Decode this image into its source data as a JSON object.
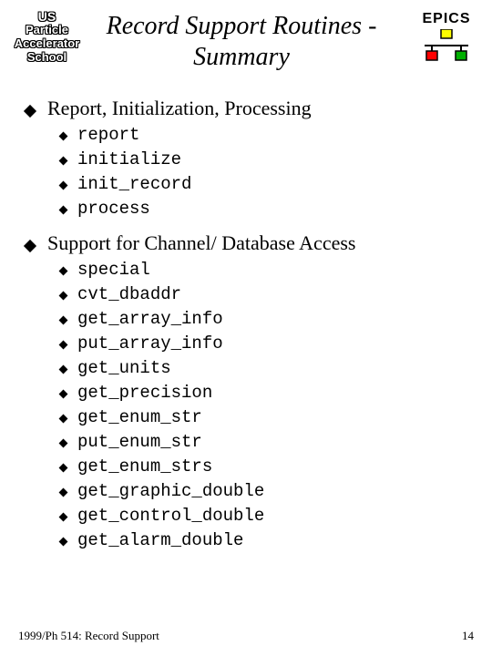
{
  "header": {
    "uspas": {
      "l1": "US",
      "l2": "Particle",
      "l3": "Accelerator",
      "l4": "School"
    },
    "title": "Record Support Routines - Summary",
    "epics_label": "EPICS"
  },
  "sections": [
    {
      "title": "Report, Initialization, Processing",
      "items": [
        "report",
        "initialize",
        "init_record",
        "process"
      ]
    },
    {
      "title": "Support for Channel/ Database Access",
      "items": [
        "special",
        "cvt_dbaddr",
        "get_array_info",
        "put_array_info",
        "get_units",
        "get_precision",
        "get_enum_str",
        "put_enum_str",
        "get_enum_strs",
        "get_graphic_double",
        "get_control_double",
        "get_alarm_double"
      ]
    }
  ],
  "footer": {
    "left": "1999/Ph 514: Record Support",
    "right": "14"
  }
}
